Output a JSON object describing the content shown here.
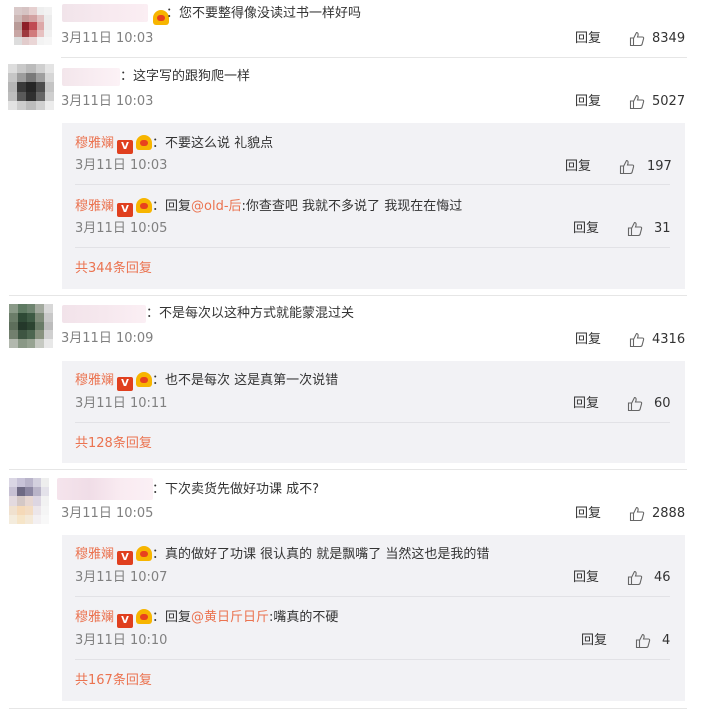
{
  "comments": [
    {
      "text": "：您不要整得像没读过书一样好吗",
      "time": "3月11日 10:03",
      "reply": "回复",
      "likes": "8349"
    },
    {
      "text": "：这字写的跟狗爬一样",
      "time": "3月11日 10:03",
      "reply": "回复",
      "likes": "5027"
    },
    {
      "text": "：不是每次以这种方式就能蒙混过关",
      "time": "3月11日 10:09",
      "reply": "回复",
      "likes": "4316"
    },
    {
      "text": "：下次卖货先做好功课 成不?",
      "time": "3月11日 10:05",
      "reply": "回复",
      "likes": "2888"
    }
  ],
  "replies": [
    {
      "author": "穆雅斓",
      "vip": "V",
      "text": "：不要这么说 礼貌点",
      "time": "3月11日 10:03",
      "reply": "回复",
      "likes": "197"
    },
    {
      "author": "穆雅斓",
      "vip": "V",
      "prefix": "：回复",
      "mention": "@old-后",
      "text": ":你查查吧 我就不多说了 我现在在悔过",
      "time": "3月11日 10:05",
      "reply": "回复",
      "likes": "31"
    },
    {
      "author": "穆雅斓",
      "vip": "V",
      "text": "：也不是每次 这是真第一次说错",
      "time": "3月11日 10:11",
      "reply": "回复",
      "likes": "60"
    },
    {
      "author": "穆雅斓",
      "vip": "V",
      "text": "：真的做好了功课 很认真的 就是飘嘴了 当然这也是我的错",
      "time": "3月11日 10:07",
      "reply": "回复",
      "likes": "46"
    },
    {
      "author": "穆雅斓",
      "vip": "V",
      "prefix": "：回复",
      "mention": "@黄日斤日斤",
      "text": ":嘴真的不硬",
      "time": "3月11日 10:10",
      "reply": "回复",
      "likes": "4"
    }
  ],
  "more": [
    "共344条回复",
    "共128条回复",
    "共167条回复"
  ],
  "colors": {
    "accent": "#eb7350",
    "reply_bg": "#f2f2f5",
    "time": "#808080"
  }
}
